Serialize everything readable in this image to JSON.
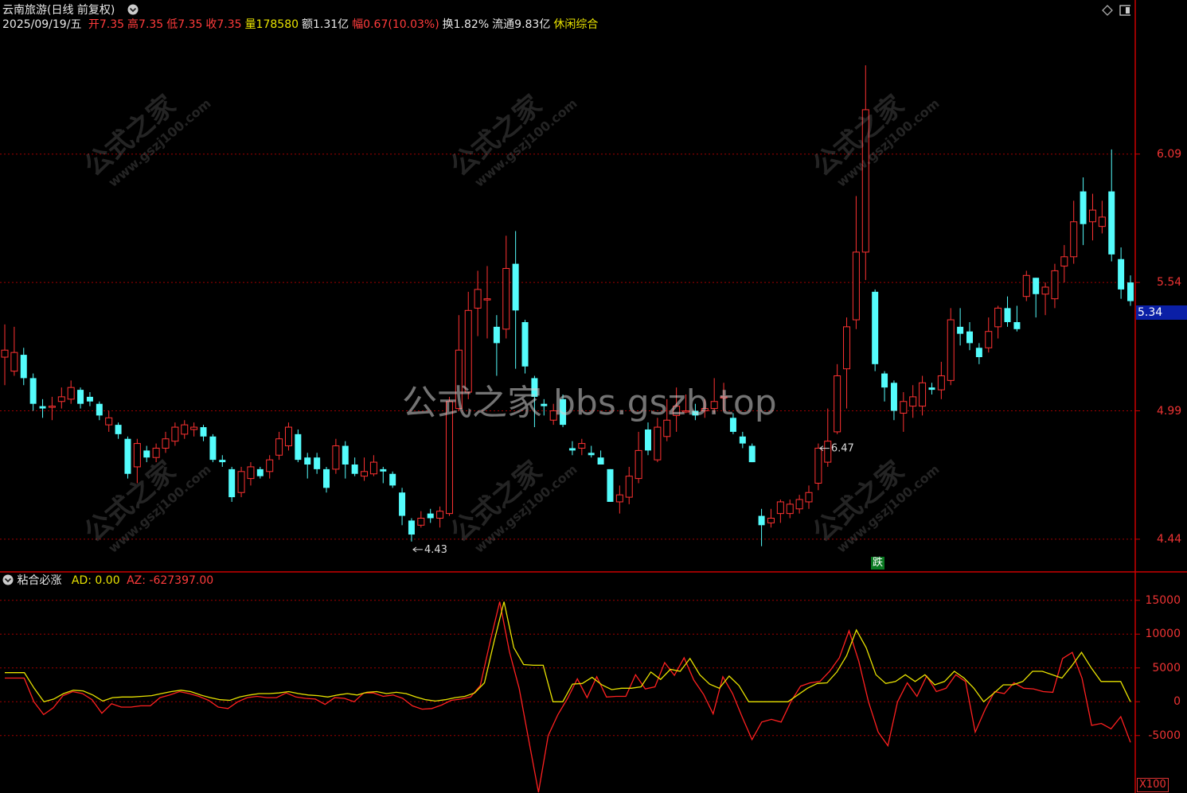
{
  "header": {
    "stock_name": "云南旅游",
    "period_label": "(日线 前复权)",
    "date_label": "2025/09/19/五",
    "fields": [
      {
        "label": "开",
        "value": "7.35",
        "color": "#ff3b3b"
      },
      {
        "label": "高",
        "value": "7.35",
        "color": "#ff3b3b"
      },
      {
        "label": "低",
        "value": "7.35",
        "color": "#ff3b3b"
      },
      {
        "label": "收",
        "value": "7.35",
        "color": "#ff3b3b"
      },
      {
        "label": "量",
        "value": "178580",
        "color": "#e8e200"
      },
      {
        "label": "额",
        "value": "1.31亿",
        "color": "#e8e8e8"
      },
      {
        "label": "幅",
        "value": "0.67(10.03%)",
        "color": "#ff3b3b"
      },
      {
        "label": "换",
        "value": "1.82%",
        "color": "#e8e8e8"
      },
      {
        "label": "流通",
        "value": "9.83亿",
        "color": "#e8e8e8"
      }
    ],
    "sector": "休闲综合"
  },
  "watermarks": {
    "center": "公式之家 bbs.gszb.top",
    "tile_big": "公式之家",
    "tile_small": "www.gszj100.com"
  },
  "indicator_header": {
    "name": "粘合必涨",
    "ad_label": "AD: 0.00",
    "az_label": "AZ: -627397.00"
  },
  "current_price": "5.34",
  "signal_badge": "跌",
  "x100_label": "X100",
  "colors": {
    "up": "#ff3232",
    "down": "#54fcfc",
    "grid": "#a00000",
    "ad": "#e8e200",
    "az": "#ff2020",
    "axis": "#cc0000"
  },
  "chart_data": [
    {
      "type": "candlestick",
      "title": "云南旅游(日线 前复权)",
      "ylim": [
        4.3,
        6.75
      ],
      "y_ticks": [
        4.44,
        4.99,
        5.54,
        6.09
      ],
      "y_tick_labels": [
        "4.44",
        "4.99",
        "5.54",
        "6.09"
      ],
      "annotations": [
        {
          "text": "6.47",
          "index": 86
        },
        {
          "text": "4.43",
          "index": 43
        }
      ],
      "candles": [
        {
          "o": 5.22,
          "c": 5.25,
          "h": 5.36,
          "l": 5.1
        },
        {
          "o": 5.16,
          "c": 5.24,
          "h": 5.35,
          "l": 5.14
        },
        {
          "o": 5.23,
          "c": 5.13,
          "h": 5.26,
          "l": 5.1
        },
        {
          "o": 5.13,
          "c": 5.02,
          "h": 5.15,
          "l": 4.99
        },
        {
          "o": 5.01,
          "c": 5.0,
          "h": 5.04,
          "l": 4.96
        },
        {
          "o": 5.01,
          "c": 5.01,
          "h": 5.05,
          "l": 4.95
        },
        {
          "o": 5.03,
          "c": 5.05,
          "h": 5.09,
          "l": 5.0
        },
        {
          "o": 5.04,
          "c": 5.09,
          "h": 5.12,
          "l": 5.02
        },
        {
          "o": 5.08,
          "c": 5.02,
          "h": 5.09,
          "l": 5.0
        },
        {
          "o": 5.05,
          "c": 5.03,
          "h": 5.07,
          "l": 5.01
        },
        {
          "o": 5.02,
          "c": 4.97,
          "h": 5.03,
          "l": 4.95
        },
        {
          "o": 4.93,
          "c": 4.96,
          "h": 4.99,
          "l": 4.9
        },
        {
          "o": 4.93,
          "c": 4.89,
          "h": 4.94,
          "l": 4.87
        },
        {
          "o": 4.87,
          "c": 4.72,
          "h": 4.88,
          "l": 4.7
        },
        {
          "o": 4.75,
          "c": 4.85,
          "h": 4.87,
          "l": 4.68
        },
        {
          "o": 4.82,
          "c": 4.79,
          "h": 4.84,
          "l": 4.77
        },
        {
          "o": 4.79,
          "c": 4.83,
          "h": 4.85,
          "l": 4.77
        },
        {
          "o": 4.83,
          "c": 4.87,
          "h": 4.9,
          "l": 4.81
        },
        {
          "o": 4.86,
          "c": 4.92,
          "h": 4.94,
          "l": 4.84
        },
        {
          "o": 4.89,
          "c": 4.93,
          "h": 4.95,
          "l": 4.87
        },
        {
          "o": 4.91,
          "c": 4.92,
          "h": 4.94,
          "l": 4.88
        },
        {
          "o": 4.92,
          "c": 4.88,
          "h": 4.93,
          "l": 4.86
        },
        {
          "o": 4.88,
          "c": 4.78,
          "h": 4.89,
          "l": 4.77
        },
        {
          "o": 4.78,
          "c": 4.77,
          "h": 4.8,
          "l": 4.75
        },
        {
          "o": 4.74,
          "c": 4.62,
          "h": 4.75,
          "l": 4.6
        },
        {
          "o": 4.64,
          "c": 4.73,
          "h": 4.75,
          "l": 4.62
        },
        {
          "o": 4.7,
          "c": 4.75,
          "h": 4.77,
          "l": 4.67
        },
        {
          "o": 4.74,
          "c": 4.71,
          "h": 4.75,
          "l": 4.7
        },
        {
          "o": 4.73,
          "c": 4.78,
          "h": 4.8,
          "l": 4.7
        },
        {
          "o": 4.8,
          "c": 4.87,
          "h": 4.9,
          "l": 4.78
        },
        {
          "o": 4.84,
          "c": 4.92,
          "h": 4.94,
          "l": 4.82
        },
        {
          "o": 4.89,
          "c": 4.78,
          "h": 4.91,
          "l": 4.77
        },
        {
          "o": 4.79,
          "c": 4.76,
          "h": 4.81,
          "l": 4.7
        },
        {
          "o": 4.79,
          "c": 4.74,
          "h": 4.81,
          "l": 4.72
        },
        {
          "o": 4.74,
          "c": 4.66,
          "h": 4.75,
          "l": 4.64
        },
        {
          "o": 4.74,
          "c": 4.84,
          "h": 4.87,
          "l": 4.72
        },
        {
          "o": 4.84,
          "c": 4.76,
          "h": 4.86,
          "l": 4.7
        },
        {
          "o": 4.76,
          "c": 4.72,
          "h": 4.79,
          "l": 4.71
        },
        {
          "o": 4.71,
          "c": 4.73,
          "h": 4.79,
          "l": 4.69
        },
        {
          "o": 4.72,
          "c": 4.77,
          "h": 4.8,
          "l": 4.71
        },
        {
          "o": 4.74,
          "c": 4.73,
          "h": 4.75,
          "l": 4.68
        },
        {
          "o": 4.72,
          "c": 4.67,
          "h": 4.73,
          "l": 4.66
        },
        {
          "o": 4.64,
          "c": 4.54,
          "h": 4.66,
          "l": 4.5
        },
        {
          "o": 4.52,
          "c": 4.46,
          "h": 4.53,
          "l": 4.43
        },
        {
          "o": 4.5,
          "c": 4.53,
          "h": 4.56,
          "l": 4.49
        },
        {
          "o": 4.55,
          "c": 4.53,
          "h": 4.57,
          "l": 4.51
        },
        {
          "o": 4.53,
          "c": 4.56,
          "h": 4.58,
          "l": 4.49
        },
        {
          "o": 4.55,
          "c": 5.03,
          "h": 5.05,
          "l": 4.54
        },
        {
          "o": 5.0,
          "c": 5.25,
          "h": 5.4,
          "l": 4.99
        },
        {
          "o": 5.07,
          "c": 5.42,
          "h": 5.5,
          "l": 5.04
        },
        {
          "o": 5.43,
          "c": 5.51,
          "h": 5.59,
          "l": 5.31
        },
        {
          "o": 5.47,
          "c": 5.47,
          "h": 5.61,
          "l": 5.3
        },
        {
          "o": 5.35,
          "c": 5.28,
          "h": 5.4,
          "l": 5.14
        },
        {
          "o": 5.34,
          "c": 5.6,
          "h": 5.74,
          "l": 5.3
        },
        {
          "o": 5.62,
          "c": 5.42,
          "h": 5.76,
          "l": 5.17
        },
        {
          "o": 5.37,
          "c": 5.18,
          "h": 5.38,
          "l": 5.15
        },
        {
          "o": 5.13,
          "c": 5.05,
          "h": 5.14,
          "l": 4.92
        },
        {
          "o": 5.02,
          "c": 5.01,
          "h": 5.04,
          "l": 4.97
        },
        {
          "o": 4.95,
          "c": 4.99,
          "h": 5.02,
          "l": 4.93
        },
        {
          "o": 5.04,
          "c": 4.93,
          "h": 5.06,
          "l": 4.92
        },
        {
          "o": 4.83,
          "c": 4.82,
          "h": 4.86,
          "l": 4.8
        },
        {
          "o": 4.83,
          "c": 4.85,
          "h": 4.87,
          "l": 4.8
        },
        {
          "o": 4.81,
          "c": 4.8,
          "h": 4.84,
          "l": 4.79
        },
        {
          "o": 4.79,
          "c": 4.76,
          "h": 4.82,
          "l": 4.76
        },
        {
          "o": 4.74,
          "c": 4.6,
          "h": 4.74,
          "l": 4.6
        },
        {
          "o": 4.6,
          "c": 4.63,
          "h": 4.67,
          "l": 4.55
        },
        {
          "o": 4.62,
          "c": 4.71,
          "h": 4.75,
          "l": 4.59
        },
        {
          "o": 4.7,
          "c": 4.82,
          "h": 4.9,
          "l": 4.68
        },
        {
          "o": 4.91,
          "c": 4.82,
          "h": 4.94,
          "l": 4.8
        },
        {
          "o": 4.78,
          "c": 4.92,
          "h": 4.96,
          "l": 4.77
        },
        {
          "o": 4.88,
          "c": 4.95,
          "h": 5.04,
          "l": 4.86
        },
        {
          "o": 4.97,
          "c": 5.01,
          "h": 5.09,
          "l": 4.9
        },
        {
          "o": 4.99,
          "c": 4.99,
          "h": 5.06,
          "l": 4.98
        },
        {
          "o": 4.99,
          "c": 4.97,
          "h": 5.02,
          "l": 4.95
        },
        {
          "o": 4.99,
          "c": 5.0,
          "h": 5.04,
          "l": 4.96
        },
        {
          "o": 5.0,
          "c": 5.03,
          "h": 5.13,
          "l": 4.98
        },
        {
          "o": 5.05,
          "c": 5.05,
          "h": 5.11,
          "l": 4.99
        },
        {
          "o": 4.96,
          "c": 4.9,
          "h": 4.98,
          "l": 4.89
        },
        {
          "o": 4.88,
          "c": 4.85,
          "h": 4.9,
          "l": 4.83
        },
        {
          "o": 4.84,
          "c": 4.77,
          "h": 4.85,
          "l": 4.77
        },
        {
          "o": 4.54,
          "c": 4.5,
          "h": 4.57,
          "l": 4.41
        },
        {
          "o": 4.51,
          "c": 4.53,
          "h": 4.57,
          "l": 4.49
        },
        {
          "o": 4.55,
          "c": 4.6,
          "h": 4.61,
          "l": 4.51
        },
        {
          "o": 4.55,
          "c": 4.59,
          "h": 4.61,
          "l": 4.53
        },
        {
          "o": 4.57,
          "c": 4.61,
          "h": 4.63,
          "l": 4.55
        },
        {
          "o": 4.6,
          "c": 4.64,
          "h": 4.67,
          "l": 4.57
        },
        {
          "o": 4.68,
          "c": 4.83,
          "h": 4.85,
          "l": 4.65
        },
        {
          "o": 4.77,
          "c": 4.86,
          "h": 5.0,
          "l": 4.75
        },
        {
          "o": 4.9,
          "c": 5.14,
          "h": 5.19,
          "l": 4.89
        },
        {
          "o": 5.17,
          "c": 5.35,
          "h": 5.39,
          "l": 5.0
        },
        {
          "o": 5.38,
          "c": 5.67,
          "h": 5.91,
          "l": 5.34
        },
        {
          "o": 5.67,
          "c": 6.28,
          "h": 6.47,
          "l": 5.55
        },
        {
          "o": 5.5,
          "c": 5.19,
          "h": 5.51,
          "l": 5.16
        },
        {
          "o": 5.15,
          "c": 5.09,
          "h": 5.16,
          "l": 5.03
        },
        {
          "o": 5.11,
          "c": 4.99,
          "h": 5.12,
          "l": 4.95
        },
        {
          "o": 4.98,
          "c": 5.03,
          "h": 5.07,
          "l": 4.9
        },
        {
          "o": 5.01,
          "c": 5.05,
          "h": 5.1,
          "l": 4.96
        },
        {
          "o": 5.01,
          "c": 5.11,
          "h": 5.14,
          "l": 4.97
        },
        {
          "o": 5.09,
          "c": 5.08,
          "h": 5.11,
          "l": 5.06
        },
        {
          "o": 5.08,
          "c": 5.14,
          "h": 5.2,
          "l": 5.04
        },
        {
          "o": 5.12,
          "c": 5.38,
          "h": 5.43,
          "l": 5.1
        },
        {
          "o": 5.35,
          "c": 5.32,
          "h": 5.43,
          "l": 5.27
        },
        {
          "o": 5.33,
          "c": 5.28,
          "h": 5.37,
          "l": 5.25
        },
        {
          "o": 5.26,
          "c": 5.22,
          "h": 5.28,
          "l": 5.19
        },
        {
          "o": 5.26,
          "c": 5.33,
          "h": 5.39,
          "l": 5.24
        },
        {
          "o": 5.35,
          "c": 5.43,
          "h": 5.44,
          "l": 5.3
        },
        {
          "o": 5.43,
          "c": 5.37,
          "h": 5.48,
          "l": 5.35
        },
        {
          "o": 5.37,
          "c": 5.34,
          "h": 5.44,
          "l": 5.33
        },
        {
          "o": 5.48,
          "c": 5.57,
          "h": 5.59,
          "l": 5.46
        },
        {
          "o": 5.56,
          "c": 5.49,
          "h": 5.56,
          "l": 5.39
        },
        {
          "o": 5.49,
          "c": 5.52,
          "h": 5.54,
          "l": 5.4
        },
        {
          "o": 5.47,
          "c": 5.59,
          "h": 5.62,
          "l": 5.43
        },
        {
          "o": 5.61,
          "c": 5.65,
          "h": 5.7,
          "l": 5.54
        },
        {
          "o": 5.65,
          "c": 5.8,
          "h": 5.89,
          "l": 5.62
        },
        {
          "o": 5.93,
          "c": 5.79,
          "h": 5.99,
          "l": 5.7
        },
        {
          "o": 5.8,
          "c": 5.85,
          "h": 5.92,
          "l": 5.72
        },
        {
          "o": 5.78,
          "c": 5.82,
          "h": 5.89,
          "l": 5.75
        },
        {
          "o": 5.93,
          "c": 5.66,
          "h": 6.11,
          "l": 5.63
        },
        {
          "o": 5.64,
          "c": 5.51,
          "h": 5.69,
          "l": 5.47
        },
        {
          "o": 5.54,
          "c": 5.46,
          "h": 5.57,
          "l": 5.44
        }
      ]
    },
    {
      "type": "line",
      "title": "粘合必涨",
      "ylim": [
        -13500,
        16500
      ],
      "y_ticks": [
        15000,
        10000,
        5000,
        0,
        -5000
      ],
      "y_tick_labels": [
        "15000",
        "10000",
        "5000",
        "0",
        "-5000"
      ],
      "y_unit_label": "X100",
      "series": [
        {
          "name": "AD",
          "values": [
            4300,
            4300,
            4300,
            2000,
            0,
            400,
            1200,
            1700,
            1600,
            1000,
            100,
            600,
            700,
            700,
            800,
            900,
            1200,
            1500,
            1700,
            1500,
            1000,
            600,
            300,
            200,
            700,
            1000,
            1200,
            1200,
            1300,
            1500,
            1200,
            1000,
            900,
            700,
            1000,
            1200,
            1000,
            1400,
            1500,
            1200,
            1400,
            1200,
            700,
            300,
            100,
            300,
            600,
            800,
            1300,
            2800,
            9000,
            14800,
            8000,
            5500,
            5400,
            5400,
            0,
            0,
            2600,
            2700,
            3600,
            2500,
            1800,
            2000,
            2000,
            2200,
            4400,
            3300,
            4800,
            4500,
            6400,
            4000,
            2600,
            2000,
            3800,
            2400,
            0,
            0,
            0,
            0,
            0,
            1000,
            2000,
            2700,
            2800,
            4400,
            6800,
            10600,
            8000,
            4000,
            2700,
            3000,
            4000,
            3000,
            4000,
            2500,
            3000,
            4500,
            3500,
            2000,
            0,
            1200,
            2500,
            2500,
            3000,
            4500,
            4500,
            4000,
            3500,
            5300,
            7300,
            5000,
            3000,
            3000,
            3000,
            0
          ]
        },
        {
          "name": "AZ",
          "values": [
            3500,
            3500,
            3500,
            0,
            -1900,
            -900,
            900,
            1500,
            1200,
            300,
            -1700,
            -300,
            -800,
            -800,
            -600,
            -600,
            600,
            1000,
            1500,
            1200,
            800,
            200,
            -800,
            -1000,
            0,
            600,
            800,
            600,
            600,
            1300,
            700,
            500,
            400,
            -400,
            600,
            500,
            0,
            1300,
            1300,
            800,
            1000,
            500,
            -600,
            -1100,
            -1000,
            -500,
            200,
            400,
            700,
            2400,
            8800,
            14800,
            7400,
            2000,
            -5700,
            -13400,
            -5000,
            -1900,
            500,
            3400,
            600,
            3700,
            700,
            800,
            800,
            4000,
            1900,
            2200,
            5800,
            3900,
            6500,
            3200,
            1100,
            -1800,
            3700,
            1200,
            -2300,
            -5600,
            -3000,
            -2600,
            -3000,
            0,
            2300,
            2800,
            3000,
            4500,
            6500,
            10500,
            6000,
            0,
            -4500,
            -6500,
            0,
            2800,
            800,
            3800,
            1500,
            2000,
            4000,
            3000,
            -4500,
            -1200,
            1500,
            1200,
            2800,
            2000,
            1900,
            1500,
            1400,
            6400,
            7300,
            3500,
            -3500,
            -3200,
            -4000,
            -2200,
            -6000
          ]
        }
      ]
    }
  ]
}
